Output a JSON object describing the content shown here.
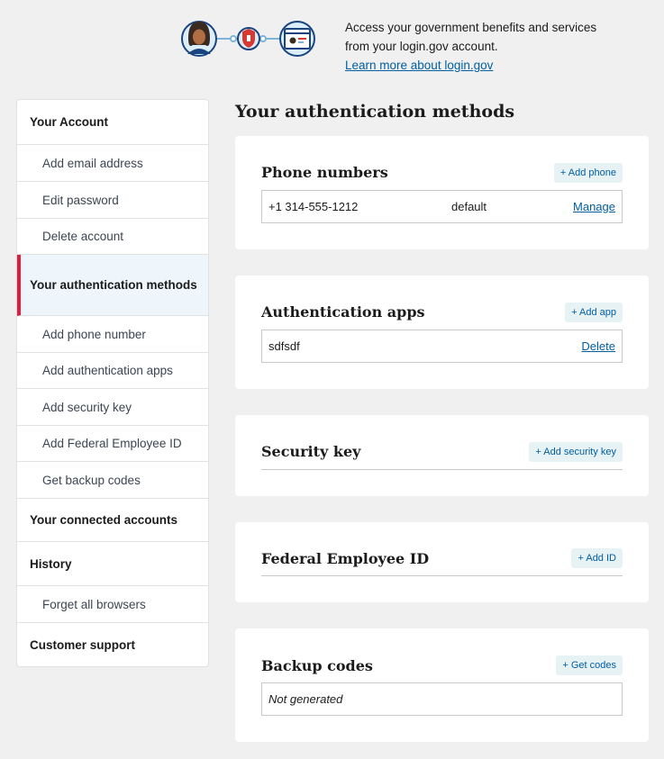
{
  "banner": {
    "text_line1": "Access your government benefits and services",
    "text_line2": "from your login.gov account.",
    "link": "Learn more about login.gov"
  },
  "sidebar": {
    "items": [
      {
        "label": "Your Account",
        "kind": "parent"
      },
      {
        "label": "Add email address",
        "kind": "child"
      },
      {
        "label": "Edit password",
        "kind": "child"
      },
      {
        "label": "Delete account",
        "kind": "child"
      },
      {
        "label": "Your authentication methods",
        "kind": "parent",
        "active": true
      },
      {
        "label": "Add phone number",
        "kind": "child"
      },
      {
        "label": "Add authentication apps",
        "kind": "child"
      },
      {
        "label": "Add security key",
        "kind": "child"
      },
      {
        "label": "Add Federal Employee ID",
        "kind": "child"
      },
      {
        "label": "Get backup codes",
        "kind": "child"
      },
      {
        "label": "Your connected accounts",
        "kind": "parent"
      },
      {
        "label": "History",
        "kind": "parent"
      },
      {
        "label": "Forget all browsers",
        "kind": "child"
      },
      {
        "label": "Customer support",
        "kind": "parent"
      }
    ]
  },
  "main": {
    "title": "Your authentication methods",
    "phone": {
      "title": "Phone numbers",
      "add_label": "+ Add phone",
      "number": "+1 314-555-1212",
      "status": "default",
      "action": "Manage"
    },
    "apps": {
      "title": "Authentication apps",
      "add_label": "+ Add app",
      "name": "sdfsdf",
      "action": "Delete"
    },
    "security_key": {
      "title": "Security key",
      "add_label": "+ Add security key"
    },
    "piv": {
      "title": "Federal Employee ID",
      "add_label": "+ Add ID"
    },
    "backup": {
      "title": "Backup codes",
      "add_label": "+ Get codes",
      "status": "Not generated"
    }
  },
  "colors": {
    "accent": "#005ea2",
    "active_marker": "#e21c3d",
    "background": "#f0f0f0"
  }
}
